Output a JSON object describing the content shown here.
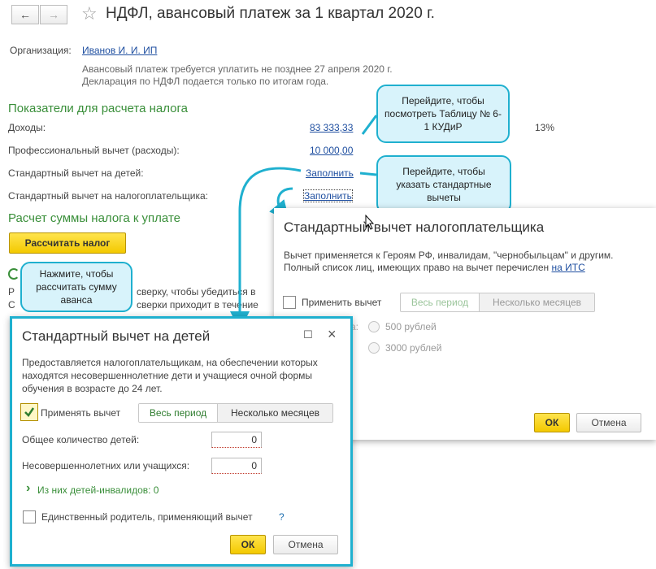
{
  "header": {
    "back_icon": "←",
    "forward_icon": "→",
    "star_icon": "☆",
    "title": "НДФЛ, авансовый платеж за 1 квартал 2020 г."
  },
  "org": {
    "label": "Организация:",
    "value": "Иванов И. И. ИП",
    "note1": "Авансовый платеж требуется уплатить не позднее 27 апреля 2020 г.",
    "note2": "Декларация по НДФЛ подается только по итогам года."
  },
  "section1": {
    "title": "Показатели для расчета налога",
    "income_label": "Доходы:",
    "income_value": "83 333,33",
    "rate": "13%",
    "expenses_label": "Профессиональный вычет (расходы):",
    "expenses_value": "10 000,00",
    "child_label": "Стандартный вычет на детей:",
    "child_link": "Заполнить",
    "taxpayer_label": "Стандартный вычет на налогоплательщика:",
    "taxpayer_link": "Заполнить"
  },
  "section2": {
    "title": "Расчет суммы налога к уплате",
    "calc_button": "Рассчитать налог",
    "frag1": "Р",
    "frag2": "С",
    "frag3": "сверку, чтобы убедиться в",
    "frag4": "сверки приходит в течение"
  },
  "callouts": {
    "kudir": "Перейдите, чтобы посмотреть Таблицу № 6-1 КУДиР",
    "deductions": "Перейдите, чтобы указать стандартные вычеты",
    "calc": "Нажмите, чтобы рассчитать сумму аванса"
  },
  "taxpayer_dialog": {
    "title": "Стандартный вычет налогоплательщика",
    "text1": "Вычет применяется к Героям РФ, инвалидам, \"чернобыльцам\" и другим.",
    "text2": "Полный список лиц, имеющих право на вычет перечислен",
    "its_link": "на ИТС",
    "apply_label": "Применить вычет",
    "period_all": "Весь период",
    "period_months": "Несколько месяцев",
    "amount_label_tail": "а:",
    "radio1": "500 рублей",
    "radio2": "3000 рублей",
    "ok": "ОК",
    "cancel": "Отмена"
  },
  "children_dialog": {
    "title": "Стандартный вычет на детей",
    "maximize_icon": "☐",
    "close_icon": "×",
    "text": "Предоставляется налогоплательщикам, на обеспечении которых находятся несовершеннолетние дети и учащиеся очной формы обучения в возрасте до 24 лет.",
    "apply_label": "Применять вычет",
    "period_all": "Весь период",
    "period_months": "Несколько месяцев",
    "total_label": "Общее количество детей:",
    "total_value": "0",
    "minors_label": "Несовершеннолетних или учащихся:",
    "minors_value": "0",
    "disabled_label": "Из них детей-инвалидов: 0",
    "chevron_icon": "›",
    "single_parent_label": "Единственный родитель, применяющий вычет",
    "help_icon": "?",
    "ok": "ОК",
    "cancel": "Отмена"
  },
  "colors": {
    "accent_green": "#3a8f3a",
    "link_blue": "#1f4fa0",
    "button_yellow": "#f3c900",
    "callout_border": "#1fb0cf",
    "callout_fill": "#d8f3fb"
  }
}
